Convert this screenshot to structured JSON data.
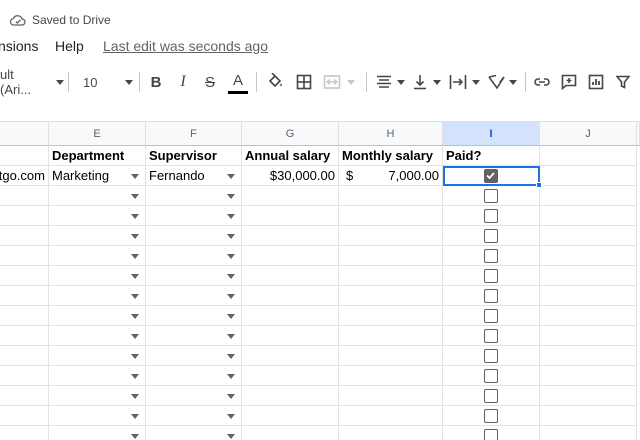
{
  "status": {
    "saved_text": "Saved to Drive"
  },
  "menu": {
    "items": [
      "nsions",
      "Help"
    ],
    "last_edit": "Last edit was seconds ago"
  },
  "toolbar": {
    "font_name": "ult (Ari...",
    "font_size": "10",
    "icons": [
      "bold-icon",
      "italic-icon",
      "strikethrough-icon",
      "text-color-icon",
      "fill-color-icon",
      "borders-icon",
      "merge-cells-icon",
      "horizontal-align-icon",
      "vertical-align-icon",
      "text-wrap-icon",
      "text-rotation-icon",
      "link-icon",
      "comment-icon",
      "chart-icon",
      "filter-icon"
    ],
    "bold_label": "B",
    "italic_label": "I",
    "strike_label": "S",
    "text_color_label": "A",
    "text_color": "#000000"
  },
  "grid": {
    "columns": [
      "E",
      "F",
      "G",
      "H",
      "I",
      "J"
    ],
    "selected_column": "I",
    "header_row": {
      "d": "",
      "e": "Department",
      "f": "Supervisor",
      "g": "Annual salary",
      "h": "Monthly salary",
      "i": "Paid?"
    },
    "first_row": {
      "d": "tgo.com",
      "e": "Marketing",
      "f": "Fernando",
      "g": "$30,000.00",
      "h_currency": "$",
      "h_value": "7,000.00",
      "i_checked": true
    },
    "empty_rows": 13
  },
  "colors": {
    "accent": "#1a73e8",
    "selected_header": "#d3e3fd"
  }
}
